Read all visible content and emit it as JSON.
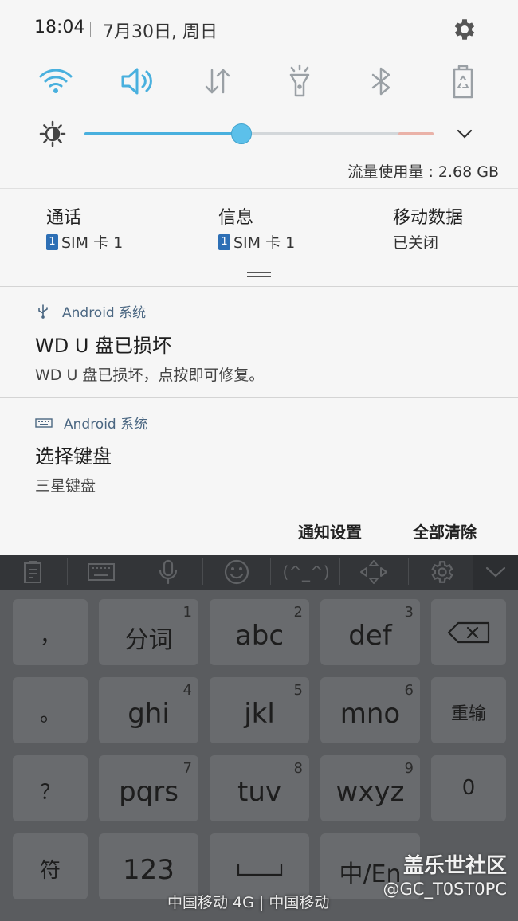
{
  "status": {
    "time": "18:04",
    "date": "7月30日, 周日"
  },
  "quick_toggles": [
    "wifi-icon",
    "sound-icon",
    "mobile-data-icon",
    "flashlight-icon",
    "bluetooth-icon",
    "power-saving-icon"
  ],
  "brightness": {
    "level": 0.45
  },
  "data_usage": "流量使用量 : 2.68 GB",
  "sim": [
    {
      "title": "通话",
      "badge": "1",
      "value": "SIM 卡 1"
    },
    {
      "title": "信息",
      "badge": "1",
      "value": "SIM 卡 1"
    },
    {
      "title": "移动数据",
      "value": "已关闭"
    }
  ],
  "notifications": [
    {
      "app": "Android 系统",
      "title": "WD U 盘已损坏",
      "body": "WD U 盘已损坏，点按即可修复。"
    },
    {
      "app": "Android 系统",
      "title": "选择键盘",
      "body": "三星键盘"
    }
  ],
  "footer": {
    "settings": "通知设置",
    "clear_all": "全部清除"
  },
  "keyboard": {
    "toolbar_emoticon": "(^_^)",
    "rows": [
      {
        "left": "，",
        "keys": [
          {
            "label": "分词",
            "num": "1"
          },
          {
            "label": "abc",
            "num": "2"
          },
          {
            "label": "def",
            "num": "3"
          }
        ],
        "right": "backspace"
      },
      {
        "left": "。",
        "keys": [
          {
            "label": "ghi",
            "num": "4"
          },
          {
            "label": "jkl",
            "num": "5"
          },
          {
            "label": "mno",
            "num": "6"
          }
        ],
        "right": "重输"
      },
      {
        "left": "？",
        "keys": [
          {
            "label": "pqrs",
            "num": "7"
          },
          {
            "label": "tuv",
            "num": "8"
          },
          {
            "label": "wxyz",
            "num": "9"
          }
        ],
        "right": "0"
      },
      {
        "left": "符",
        "keys": [
          {
            "label": "123"
          },
          {
            "label": "space"
          },
          {
            "label": "中/En"
          }
        ],
        "right": ""
      }
    ]
  },
  "carrier": "中国移动 4G | 中国移动",
  "watermark": {
    "line1": "盖乐世社区",
    "line2": "@GC_T0ST0PC"
  },
  "colors": {
    "accent": "#49b0de",
    "shade_bg": "#f6f6f6",
    "keyboard_bg": "#5a5c5f",
    "key_bg": "#696b6e"
  }
}
